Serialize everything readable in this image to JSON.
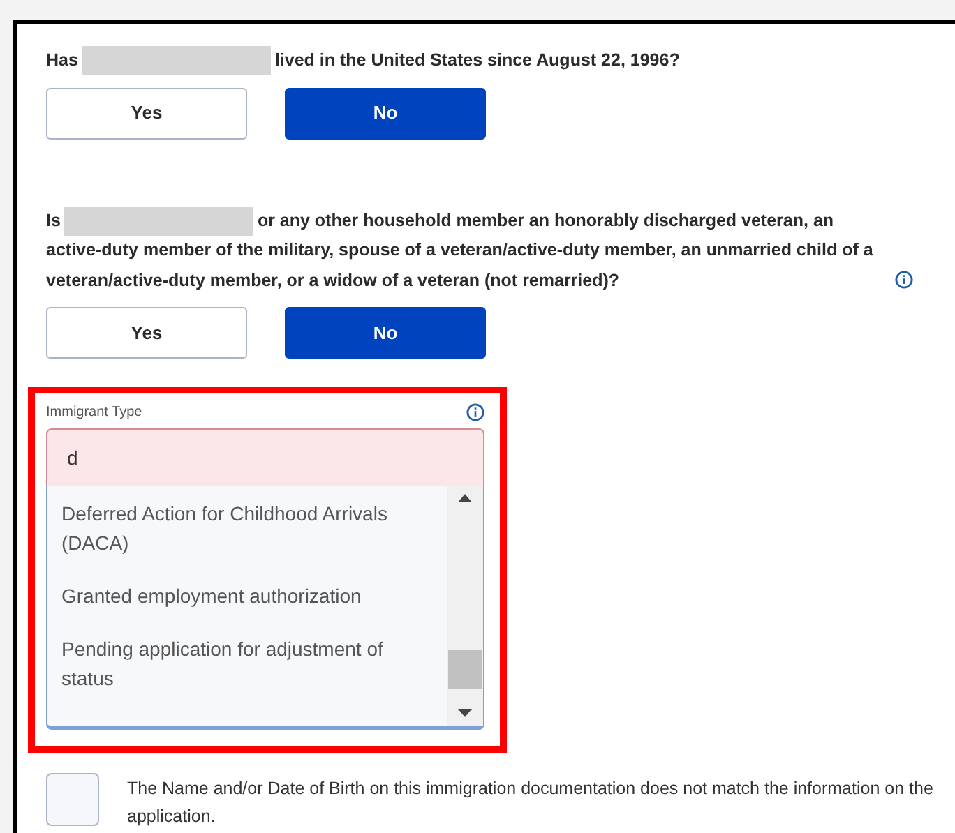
{
  "questions": [
    {
      "text_before": "Has",
      "text_after": "lived in the United States since August 22, 1996?",
      "info": false,
      "answers": [
        {
          "label": "Yes",
          "selected": false
        },
        {
          "label": "No",
          "selected": true
        }
      ]
    },
    {
      "text_before": "Is",
      "text_after": "or any other household member an honorably discharged veteran, an active-duty member of the military, spouse of a veteran/active-duty member, an unmarried child of a veteran/active-duty member, or a widow of a veteran (not remarried)?",
      "info": true,
      "answers": [
        {
          "label": "Yes",
          "selected": false
        },
        {
          "label": "No",
          "selected": true
        }
      ]
    }
  ],
  "immigrant_type": {
    "label": "Immigrant Type",
    "value": "d",
    "highlighted": true,
    "options": [
      "Deferred Action for Childhood Arrivals (DACA)",
      "Granted employment authorization",
      "Pending application for adjustment of status"
    ]
  },
  "mismatch_checkbox": {
    "label": "The Name and/or Date of Birth on this immigration documentation does not match the information on the application.",
    "checked": false
  }
}
